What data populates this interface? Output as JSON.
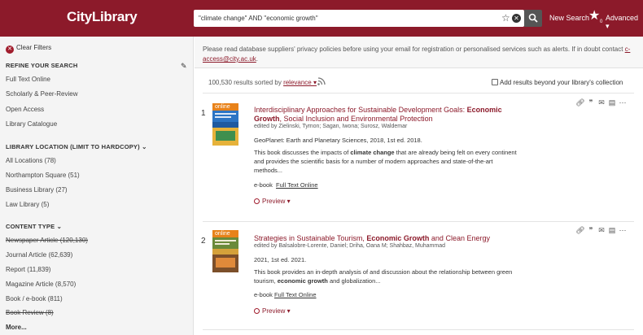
{
  "header": {
    "brand": "CityLibrary",
    "search_value": "\"climate change\" AND \"economic growth\"",
    "new_search": "New Search",
    "starred_count": "0",
    "advanced": "Advanced ▾"
  },
  "sidebar": {
    "clear_filters": "Clear Filters",
    "refine_heading": "REFINE YOUR SEARCH",
    "refine_items": [
      "Full Text Online",
      "Scholarly & Peer-Review",
      "Open Access",
      "Library Catalogue"
    ],
    "location_heading": "LIBRARY LOCATION (LIMIT TO HARDCOPY)",
    "location_items": [
      "All Locations (78)",
      "Northampton Square (51)",
      "Business Library (27)",
      "Law Library (5)"
    ],
    "content_heading": "CONTENT TYPE",
    "content_items": [
      "Newspaper Article (120,130)",
      "Journal Article (62,639)",
      "Report (11,839)",
      "Magazine Article (8,570)",
      "Book / e-book (811)",
      "Book Review (8)"
    ],
    "more": "More..."
  },
  "main": {
    "notice_text": "Please read database suppliers' privacy policies before using your email for registration or personalised services such as alerts. If in doubt contact ",
    "notice_email": "c-access@city.ac.uk",
    "notice_end": ".",
    "results_count": "100,530 results sorted by ",
    "sort_label": "relevance ▾",
    "beyond_label": "Add results beyond your library's collection"
  },
  "records": [
    {
      "num": "1",
      "badge": "online",
      "title_a": "Interdisciplinary Approaches for Sustainable Development Goals: ",
      "title_b": "Economic Growth",
      "title_c": ", Social Inclusion and Environmental Protection",
      "authors": "edited by Zielinski, Tymon; Sagan, Iwona; Surosz, Waldemar",
      "source": "GeoPlanet: Earth and Planetary Sciences, 2018, 1st ed. 2018.",
      "desc_a": "This book discusses the impacts of ",
      "desc_b": "climate change",
      "desc_c": " that are already being felt on every continent and provides the scientific basis for a number of modern approaches and state-of-the-art methods...",
      "format": "e-book",
      "format_link": "Full Text Online",
      "preview": "Preview ▾"
    },
    {
      "num": "2",
      "badge": "online",
      "title_a": "Strategies in Sustainable Tourism, ",
      "title_b": "Economic Growth",
      "title_c": " and Clean Energy",
      "authors": "edited by Balsalobre-Lorente, Daniel; Driha, Oana M; Shahbaz, Muhammad",
      "source": "2021, 1st ed. 2021.",
      "desc_a": "This book provides an in-depth analysis of and discussion about the relationship between green tourism, ",
      "desc_b": "economic growth",
      "desc_c": " and globalization...",
      "format": "e-book",
      "format_link": "Full Text Online",
      "preview": "Preview ▾"
    }
  ],
  "colors": {
    "header_bg": "#8c1a2a",
    "accent": "#8c1a2a",
    "online_badge": "#e8821a"
  }
}
